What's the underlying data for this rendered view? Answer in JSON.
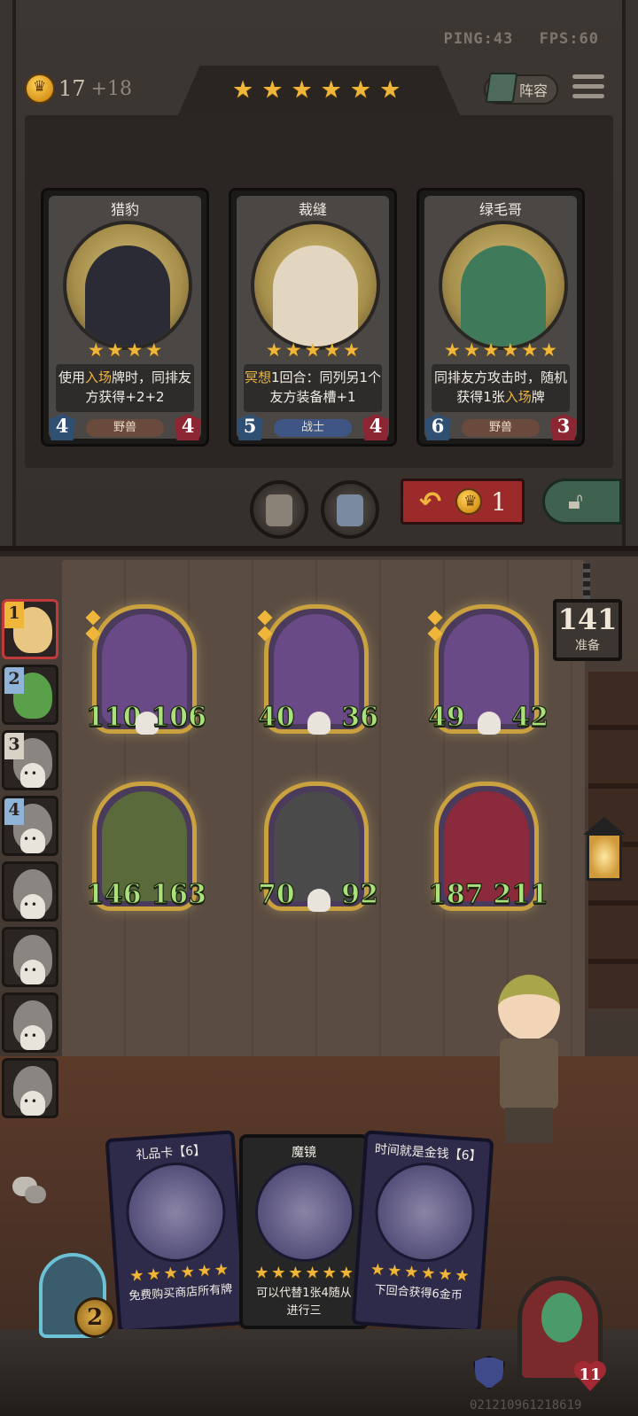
{
  "status": {
    "ping": "PING:43",
    "fps": "FPS:60"
  },
  "gold": {
    "value": "17",
    "bonus": "+18"
  },
  "tavern_stars": 6,
  "lineup_label": "阵容",
  "shop_cards": [
    {
      "name": "猎豹",
      "stars": 4,
      "desc_pre": "使用",
      "desc_hl": "入场",
      "desc_post": "牌时，同排友方获得+2+2",
      "attack": "4",
      "health": "4",
      "tribe": "野兽",
      "tribe_type": "beast",
      "art_color": "#2b2b35"
    },
    {
      "name": "裁缝",
      "stars": 5,
      "desc_pre": "",
      "desc_hl": "冥想",
      "desc_post": "1回合：同列另1个友方装备槽+1",
      "attack": "5",
      "health": "4",
      "tribe": "战士",
      "tribe_type": "warrior",
      "art_color": "#e2d6c0"
    },
    {
      "name": "绿毛哥",
      "stars": 6,
      "desc_pre": "同排友方攻击时，随机获得1张",
      "desc_hl": "入场",
      "desc_post": "牌",
      "attack": "6",
      "health": "3",
      "tribe": "野兽",
      "tribe_type": "beast",
      "art_color": "#3f7a5a"
    }
  ],
  "refresh_cost": "1",
  "ready": {
    "count": "141",
    "label": "准备"
  },
  "players": [
    {
      "rank": "1",
      "alive": true,
      "face_color": "#e8c784"
    },
    {
      "rank": "2",
      "alive": true,
      "face_color": "#5aa04a"
    },
    {
      "rank": "3",
      "alive": false,
      "face_color": "#8a8580"
    },
    {
      "rank": "4",
      "alive": false,
      "face_color": "#8a8580"
    },
    {
      "rank": "",
      "alive": false,
      "face_color": "#8a8580"
    },
    {
      "rank": "",
      "alive": false,
      "face_color": "#8a8580"
    },
    {
      "rank": "",
      "alive": false,
      "face_color": "#8a8580"
    },
    {
      "rank": "",
      "alive": false,
      "face_color": "#8a8580"
    }
  ],
  "minions": [
    {
      "attack": "110",
      "health": "106",
      "skull": true,
      "gems": 2,
      "color": "#6a4a86"
    },
    {
      "attack": "40",
      "health": "36",
      "skull": true,
      "gems": 2,
      "color": "#6a4a86"
    },
    {
      "attack": "49",
      "health": "42",
      "skull": true,
      "gems": 2,
      "color": "#6a4a86"
    },
    {
      "attack": "146",
      "health": "163",
      "skull": false,
      "gems": 0,
      "color": "#5a6a3a"
    },
    {
      "attack": "70",
      "health": "92",
      "skull": true,
      "gems": 0,
      "color": "#4a4a4a"
    },
    {
      "attack": "187",
      "health": "211",
      "skull": false,
      "gems": 0,
      "color": "#8a2a3a"
    }
  ],
  "hand_cards": [
    {
      "name": "礼品卡【6】",
      "stars": 6,
      "desc": "免费购买商店所有牌"
    },
    {
      "name": "魔镜",
      "stars": 6,
      "desc": "可以代替1张4随从进行三"
    },
    {
      "name": "时间就是金钱【6】",
      "stars": 6,
      "desc": "下回合获得6金币"
    }
  ],
  "tavern_tier": "2",
  "hero_health": "11",
  "uid": "0212109612186​19"
}
